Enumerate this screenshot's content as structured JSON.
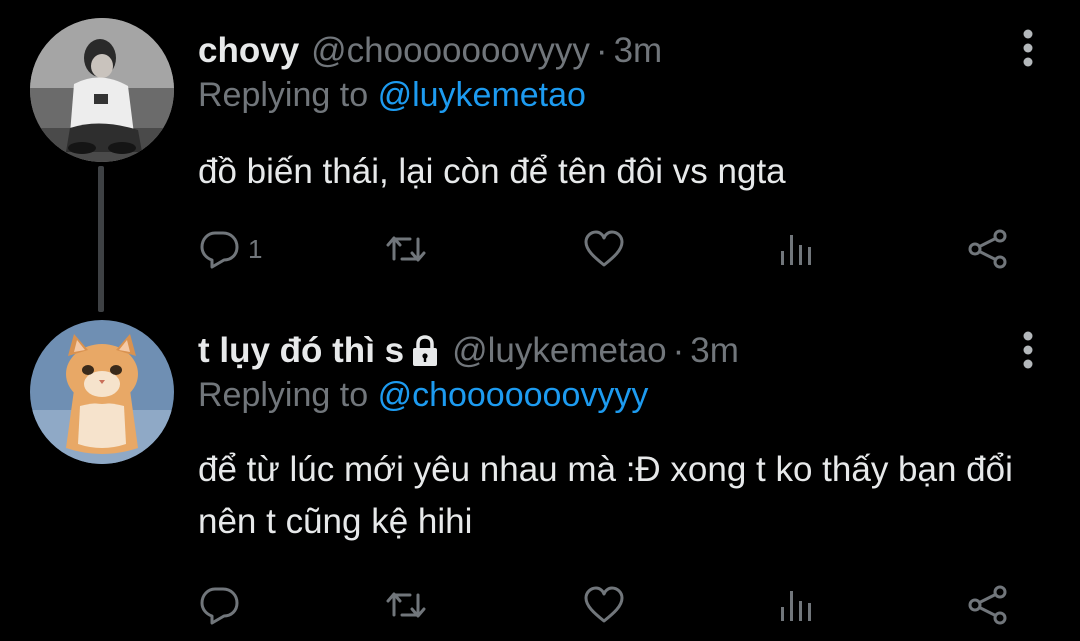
{
  "tweets": [
    {
      "display_name": "chovy",
      "handle": "@chooooooovyyy",
      "separator": "·",
      "time": "3m",
      "replying_prefix": "Replying to",
      "replying_to": "@luykemetao",
      "text": "đồ biến thái, lại còn để tên đôi vs ngta",
      "reply_count": "1",
      "protected": false
    },
    {
      "display_name": "t lụy đó thì s",
      "handle": "@luykemetao",
      "separator": "·",
      "time": "3m",
      "replying_prefix": "Replying to",
      "replying_to": "@chooooooovyyy",
      "text": "để từ lúc mới yêu nhau mà :Đ xong t ko thấy bạn đổi nên t cũng kệ hihi",
      "reply_count": "",
      "protected": true
    }
  ],
  "colors": {
    "background": "#000000",
    "primary_text": "#e7e9ea",
    "secondary_text": "#71767b",
    "link": "#1d9bf0",
    "thread_line": "#3e4144"
  },
  "icons": {
    "more": "more-vertical-icon",
    "reply": "reply-icon",
    "retweet": "retweet-icon",
    "like": "heart-icon",
    "views": "views-chart-icon",
    "share": "share-icon",
    "lock": "lock-icon"
  }
}
